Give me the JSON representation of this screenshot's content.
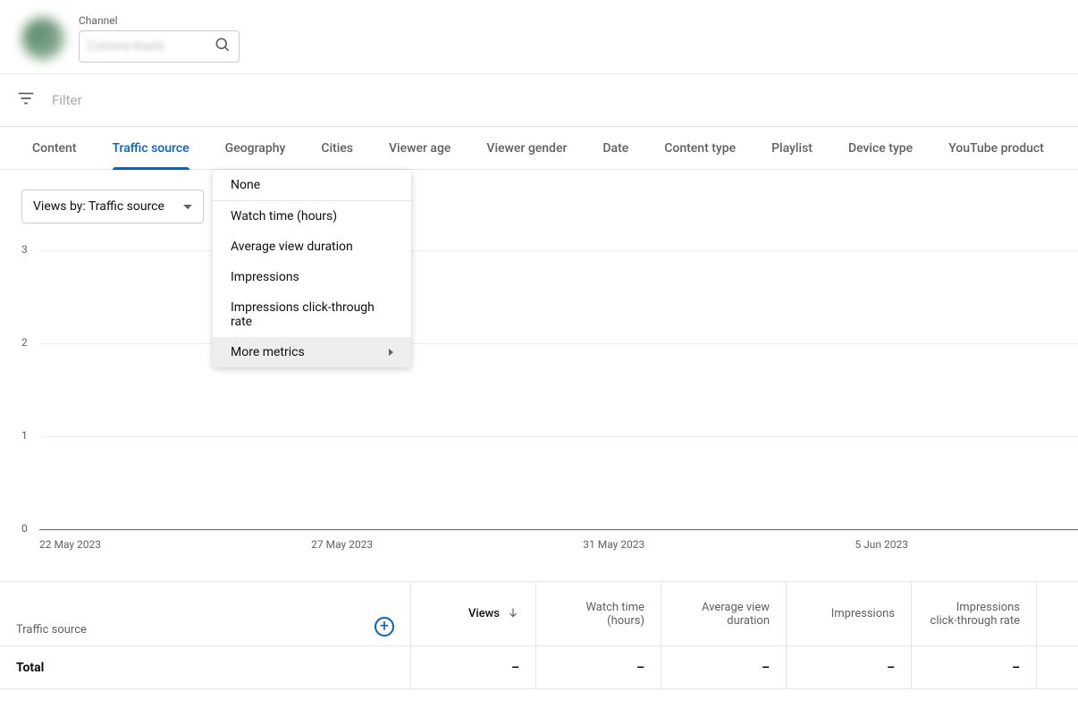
{
  "header": {
    "channel_label": "Channel",
    "channel_name": "Corinna Keefe"
  },
  "filter": {
    "placeholder": "Filter"
  },
  "tabs": [
    {
      "label": "Content",
      "selected": false
    },
    {
      "label": "Traffic source",
      "selected": true
    },
    {
      "label": "Geography",
      "selected": false
    },
    {
      "label": "Cities",
      "selected": false
    },
    {
      "label": "Viewer age",
      "selected": false
    },
    {
      "label": "Viewer gender",
      "selected": false
    },
    {
      "label": "Date",
      "selected": false
    },
    {
      "label": "Content type",
      "selected": false
    },
    {
      "label": "Playlist",
      "selected": false
    },
    {
      "label": "Device type",
      "selected": false
    },
    {
      "label": "YouTube product",
      "selected": false
    }
  ],
  "views_by": {
    "label": "Views by: Traffic source"
  },
  "dropdown": {
    "items": [
      "None",
      "Watch time (hours)",
      "Average view duration",
      "Impressions",
      "Impressions click-through rate",
      "More metrics"
    ],
    "hovered_index": 5
  },
  "chart_data": {
    "type": "line",
    "title": "",
    "xlabel": "",
    "ylabel": "",
    "ylim": [
      0,
      3
    ],
    "y_ticks": [
      0,
      1,
      2,
      3
    ],
    "categories": [
      "22 May 2023",
      "27 May 2023",
      "31 May 2023",
      "5 Jun 2023"
    ],
    "series": []
  },
  "table": {
    "columns": [
      "Traffic source",
      "Views",
      "Watch time (hours)",
      "Average view duration",
      "Impressions",
      "Impressions click-through rate"
    ],
    "sort_column": "Views",
    "sort_dir": "desc",
    "rows": [
      {
        "label": "Total",
        "values": [
          "–",
          "–",
          "–",
          "–",
          "–"
        ]
      }
    ]
  }
}
